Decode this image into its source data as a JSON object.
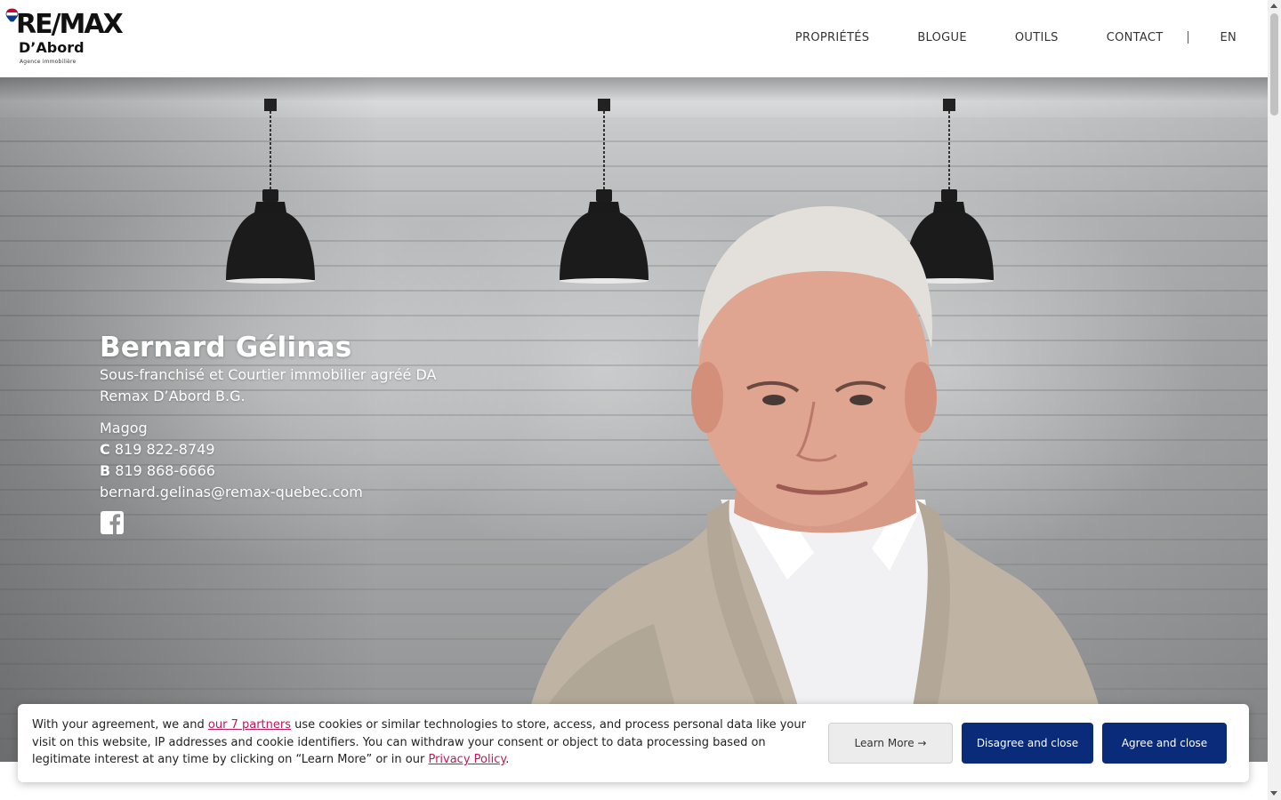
{
  "brand": {
    "wordmark": "RE/MAX",
    "name": "D’Abord",
    "tagline": "Agence immobilière",
    "colors": {
      "red": "#d6001c",
      "blue": "#0a3a8a",
      "dark": "#111111"
    }
  },
  "nav": {
    "items": [
      {
        "label": "PROPRIÉTÉS"
      },
      {
        "label": "BLOGUE"
      },
      {
        "label": "OUTILS"
      },
      {
        "label": "CONTACT"
      }
    ],
    "lang": "EN"
  },
  "agent": {
    "name": "Bernard Gélinas",
    "title": "Sous-franchisé et Courtier immobilier agréé DA",
    "agency": "Remax D’Abord B.G.",
    "city": "Magog",
    "cell_label": "C",
    "cell": "819 822-8749",
    "office_label": "B",
    "office": "819 868-6666",
    "email": "bernard.gelinas@remax-quebec.com",
    "social_icon": "facebook-icon"
  },
  "cookie": {
    "text_1": "With your agreement, we and ",
    "partners_link": "our 7 partners",
    "text_2": " use cookies or similar technologies to store, access, and process personal data like your visit on this website, IP addresses and cookie identifiers. You can withdraw your consent or object to data processing based on legitimate interest at any time by clicking on “Learn More” or in our ",
    "privacy_link": "Privacy Policy",
    "text_3": ".",
    "learn_more": "Learn More →",
    "disagree": "Disagree and close",
    "agree": "Agree and close",
    "button_color": "#0a2a7a",
    "link_color": "#c2185b"
  }
}
